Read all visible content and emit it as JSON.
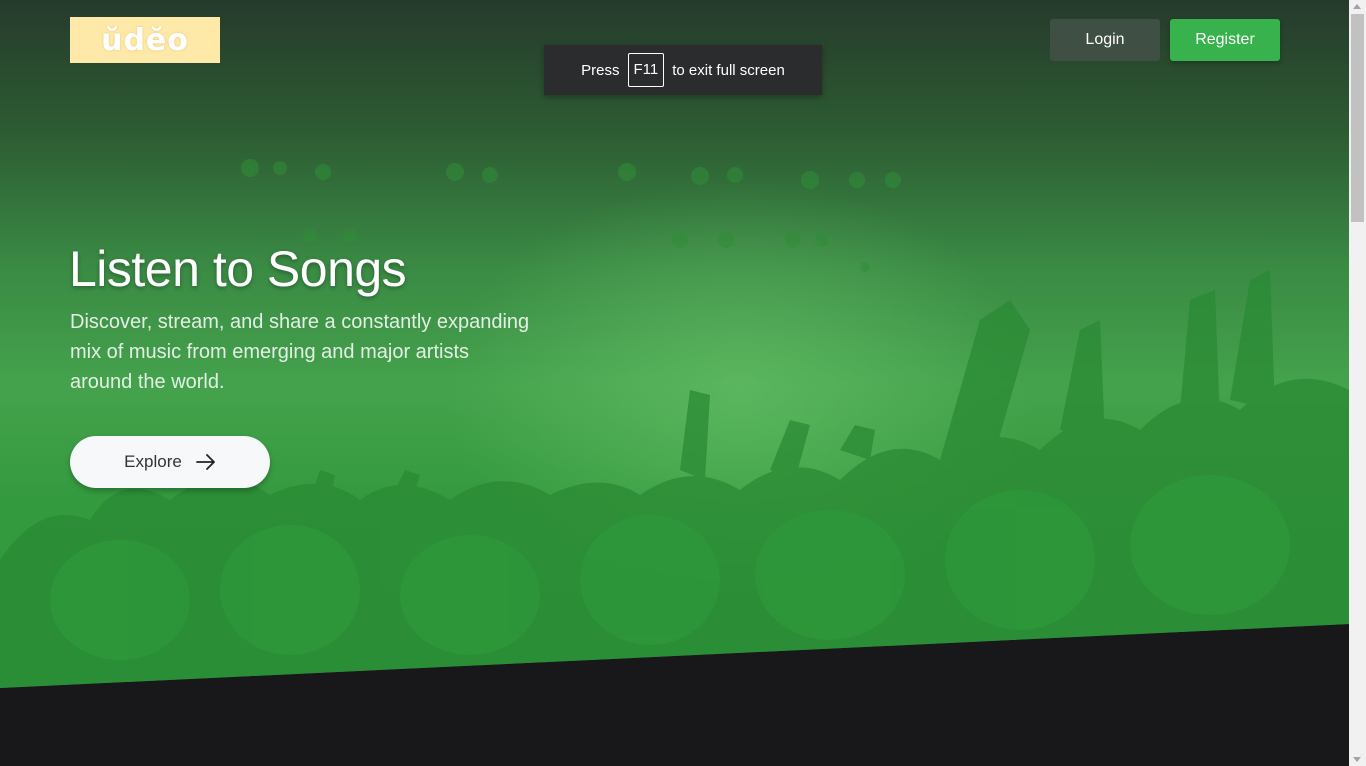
{
  "header": {
    "logo_text": "ŭdĕo",
    "login_label": "Login",
    "register_label": "Register"
  },
  "fullscreen_notice": {
    "prefix": "Press",
    "key": "F11",
    "suffix": "to exit full screen"
  },
  "hero": {
    "title": "Listen to Songs",
    "subtitle": "Discover, stream, and share a constantly expanding mix of music from emerging and major artists around the world.",
    "explore_label": "Explore",
    "explore_icon": "arrow-right-icon"
  },
  "colors": {
    "accent": "#37b24d",
    "login_bg": "#3f4f44",
    "logo_bg": "#ffe9a8",
    "dark_bg": "#18181b"
  }
}
